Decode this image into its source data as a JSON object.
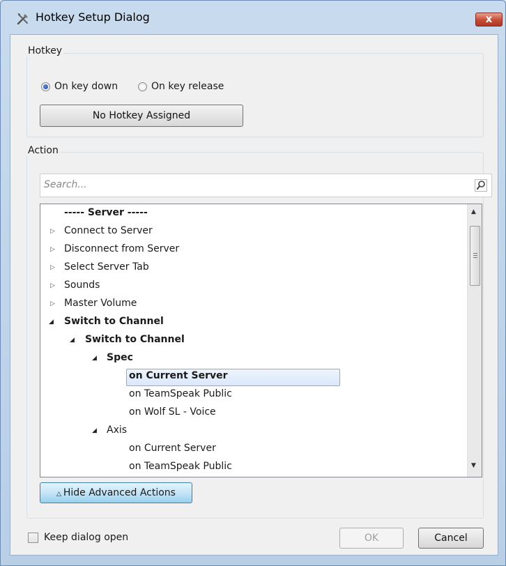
{
  "window": {
    "title": "Hotkey Setup Dialog",
    "close_glyph": "x"
  },
  "hotkey": {
    "group_label": "Hotkey",
    "radio_down": "On key down",
    "radio_release": "On key release",
    "selected": "On key down",
    "assign_button": "No Hotkey Assigned"
  },
  "action": {
    "group_label": "Action",
    "search_placeholder": "Search...",
    "tree": [
      {
        "label": "----- Server -----",
        "bold": true
      },
      {
        "label": "Connect to Server",
        "bold": false,
        "arrow": "collapsed"
      },
      {
        "label": "Disconnect from Server",
        "bold": false,
        "arrow": "collapsed"
      },
      {
        "label": "Select Server Tab",
        "bold": false,
        "arrow": "collapsed"
      },
      {
        "label": "Sounds",
        "bold": false,
        "arrow": "collapsed"
      },
      {
        "label": "Master Volume",
        "bold": false,
        "arrow": "collapsed"
      },
      {
        "label": "Switch to Channel",
        "bold": true,
        "arrow": "expanded"
      },
      {
        "label": "Switch to Channel",
        "bold": true,
        "arrow": "expanded"
      },
      {
        "label": "Spec",
        "bold": true,
        "arrow": "expanded"
      },
      {
        "label": "on Current Server",
        "bold": true,
        "selected": true
      },
      {
        "label": "on TeamSpeak Public",
        "bold": false
      },
      {
        "label": "on Wolf SL - Voice",
        "bold": false
      },
      {
        "label": "Axis",
        "bold": false,
        "arrow": "expanded"
      },
      {
        "label": "on Current Server",
        "bold": false
      },
      {
        "label": "on TeamSpeak Public",
        "bold": false
      }
    ],
    "advanced_button": "Hide Advanced Actions"
  },
  "footer": {
    "keep_open_label": "Keep dialog open",
    "keep_open_checked": false,
    "ok_label": "OK",
    "cancel_label": "Cancel"
  },
  "colors": {
    "selection_border": "#84acdd",
    "accent_button": "#98d1ef",
    "close_button": "#c64a34"
  }
}
